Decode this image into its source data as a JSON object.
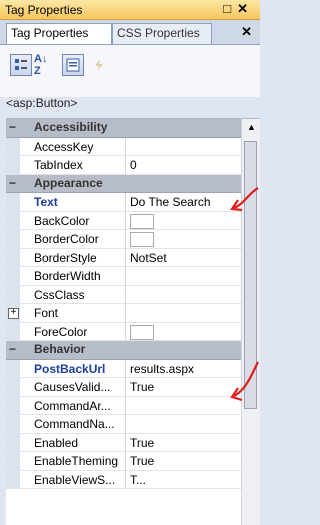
{
  "window": {
    "title": "Tag Properties",
    "btn_pin": "□",
    "btn_close": "✕"
  },
  "tabs": {
    "active": "Tag Properties",
    "inactive": "CSS Properties",
    "close": "✕"
  },
  "selected_element": "<asp:Button>",
  "toolbar": {
    "az_label": "A↓ Z"
  },
  "rows": [
    {
      "type": "cat",
      "sign": "−",
      "name": "Accessibility"
    },
    {
      "type": "prop",
      "name": "AccessKey",
      "value": ""
    },
    {
      "type": "prop",
      "name": "TabIndex",
      "value": "0"
    },
    {
      "type": "cat",
      "sign": "−",
      "name": "Appearance"
    },
    {
      "type": "prop",
      "name": "Text",
      "value": "Do The Search",
      "bold": true
    },
    {
      "type": "prop",
      "name": "BackColor",
      "value": "",
      "swatch": true
    },
    {
      "type": "prop",
      "name": "BorderColor",
      "value": "",
      "swatch": true
    },
    {
      "type": "prop",
      "name": "BorderStyle",
      "value": "NotSet"
    },
    {
      "type": "prop",
      "name": "BorderWidth",
      "value": ""
    },
    {
      "type": "prop",
      "name": "CssClass",
      "value": ""
    },
    {
      "type": "exp",
      "name": "Font",
      "value": "",
      "box": "+"
    },
    {
      "type": "prop",
      "name": "ForeColor",
      "value": "",
      "swatch": true
    },
    {
      "type": "cat",
      "sign": "−",
      "name": "Behavior"
    },
    {
      "type": "prop",
      "name": "PostBackUrl",
      "value": "results.aspx",
      "bold": true
    },
    {
      "type": "prop",
      "name": "CausesValid...",
      "value": "True"
    },
    {
      "type": "prop",
      "name": "CommandAr...",
      "value": ""
    },
    {
      "type": "prop",
      "name": "CommandNa...",
      "value": ""
    },
    {
      "type": "prop",
      "name": "Enabled",
      "value": "True"
    },
    {
      "type": "prop",
      "name": "EnableTheming",
      "value": "True"
    },
    {
      "type": "prop",
      "name": "EnableViewS...",
      "value": "T..."
    }
  ]
}
